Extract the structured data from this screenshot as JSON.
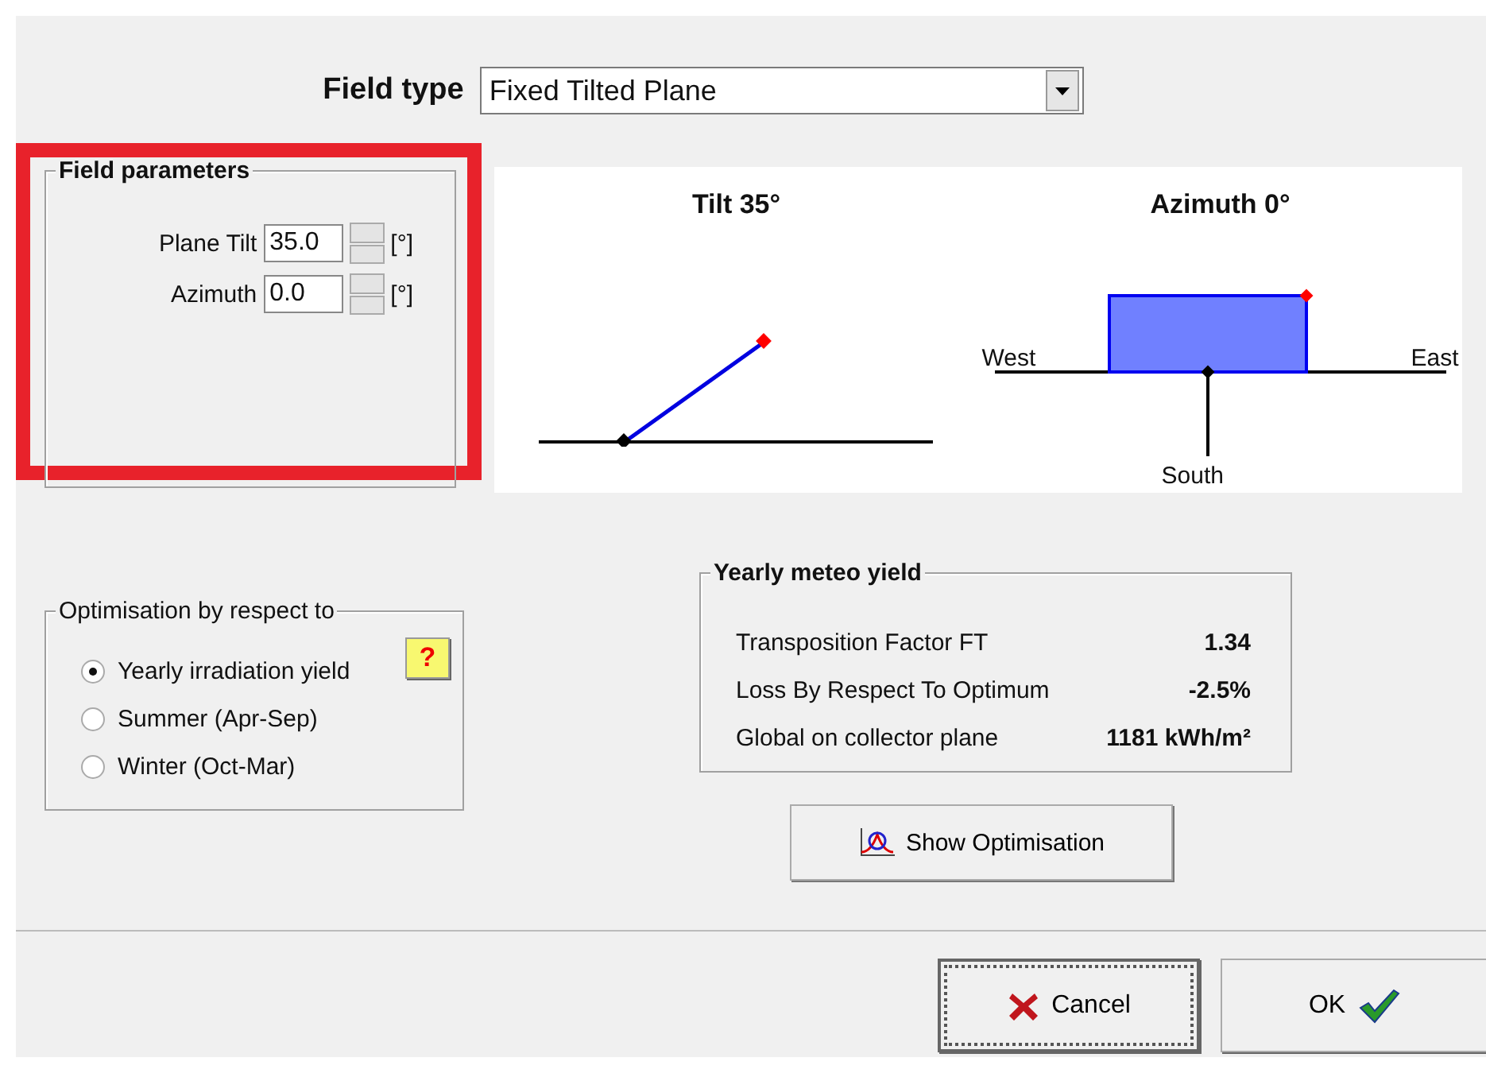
{
  "field_type": {
    "label": "Field type",
    "value": "Fixed Tilted Plane"
  },
  "field_parameters": {
    "title": "Field parameters",
    "highlighted": true,
    "rows": [
      {
        "label": "Plane Tilt",
        "value": "35.0",
        "unit": "[°]"
      },
      {
        "label": "Azimuth",
        "value": "0.0",
        "unit": "[°]"
      }
    ]
  },
  "diagrams": {
    "tilt_title": "Tilt 35°",
    "azimuth_title": "Azimuth 0°",
    "west": "West",
    "east": "East",
    "south": "South"
  },
  "optimisation": {
    "title": "Optimisation by respect to",
    "help": "?",
    "options": [
      {
        "label": "Yearly irradiation yield",
        "selected": true
      },
      {
        "label": "Summer (Apr-Sep)",
        "selected": false
      },
      {
        "label": "Winter (Oct-Mar)",
        "selected": false
      }
    ]
  },
  "meteo_yield": {
    "title": "Yearly meteo yield",
    "rows": [
      {
        "label": "Transposition Factor FT",
        "value": "1.34"
      },
      {
        "label": "Loss By Respect To Optimum",
        "value": "-2.5%"
      },
      {
        "label": "Global on collector plane",
        "value": "1181 kWh/m²"
      }
    ]
  },
  "show_optimisation": "Show Optimisation",
  "buttons": [
    {
      "kind": "cancel",
      "label": "Cancel",
      "focused": true
    },
    {
      "kind": "ok",
      "label": "OK",
      "focused": false
    }
  ]
}
